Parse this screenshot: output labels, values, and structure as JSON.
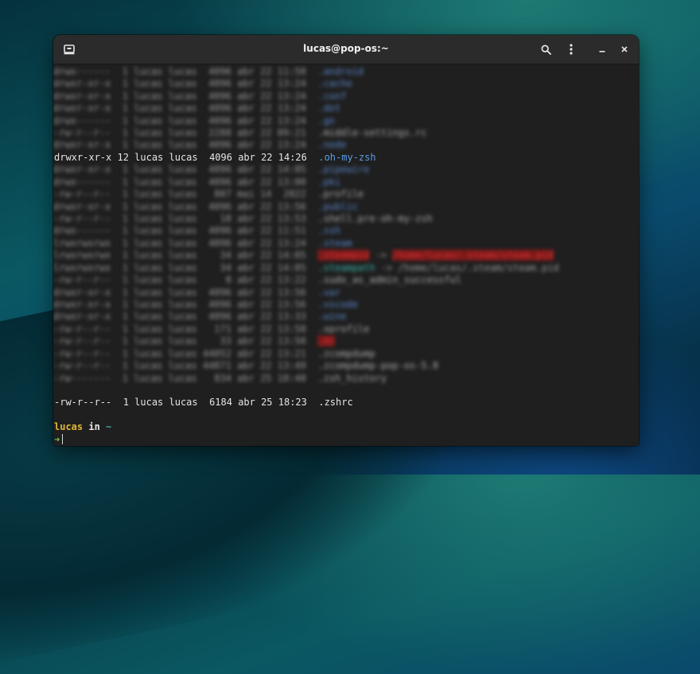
{
  "window": {
    "title": "lucas@pop-os:~",
    "new_tab_icon": "new-tab-icon",
    "search_icon": "search-icon",
    "menu_icon": "kebab-menu-icon",
    "minimize_icon": "minimize-icon",
    "close_icon": "close-icon"
  },
  "terminal": {
    "highlight_line_1": {
      "meta": "drwxr-xr-x 12 lucas lucas  4096 abr 22 14:26  ",
      "name": ".oh-my-zsh"
    },
    "highlight_line_2": {
      "meta": "-rw-r--r--  1 lucas lucas  6184 abr 25 18:23  ",
      "name": ".zshrc"
    },
    "prompt": {
      "user": "lucas",
      "in": " in ",
      "cwd": "~",
      "arrow": "➜"
    }
  },
  "colors": {
    "directory": "#5c9ce6",
    "prompt_user": "#e0b637",
    "prompt_cwd": "#4aa0a8",
    "prompt_arrow": "#72c24a"
  }
}
